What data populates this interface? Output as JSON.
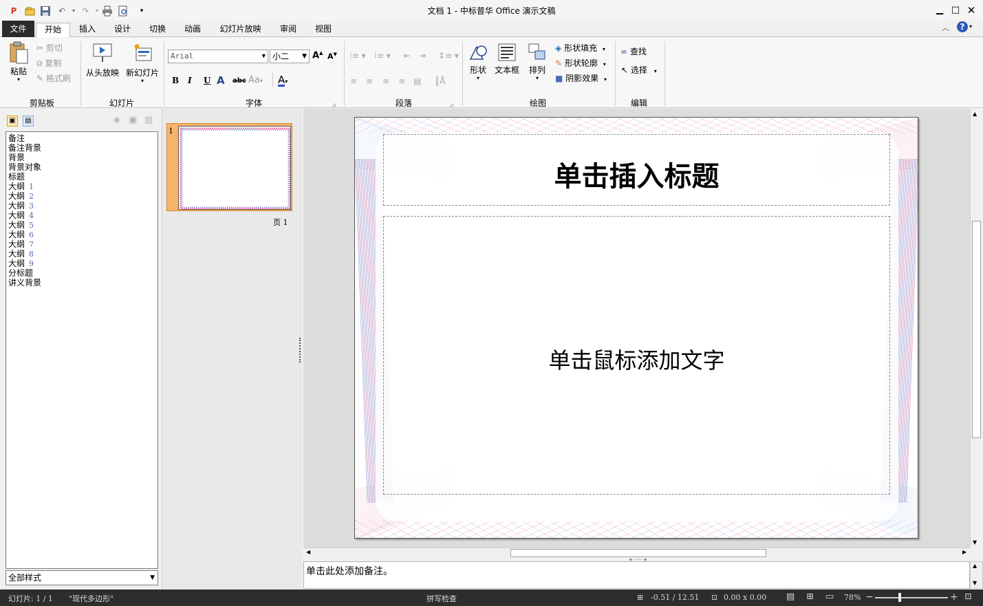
{
  "window": {
    "title": "文档 1 - 中标普华 Office 演示文稿"
  },
  "tabs": [
    {
      "label": "文件"
    },
    {
      "label": "开始"
    },
    {
      "label": "插入"
    },
    {
      "label": "设计"
    },
    {
      "label": "切换"
    },
    {
      "label": "动画"
    },
    {
      "label": "幻灯片放映"
    },
    {
      "label": "审阅"
    },
    {
      "label": "视图"
    }
  ],
  "ribbon": {
    "clipboard": {
      "label": "剪贴板",
      "paste": "粘贴",
      "cut": "剪切",
      "copy": "复制",
      "format_painter": "格式刷"
    },
    "slides": {
      "label": "幻灯片",
      "from_start": "从头放映",
      "new_slide": "新幻灯片"
    },
    "font": {
      "label": "字体",
      "font_name": "Arial",
      "font_size": "小二",
      "bold": "B",
      "italic": "I",
      "underline": "U",
      "strike": "abc",
      "case": "Aa",
      "color_letter": "A"
    },
    "paragraph": {
      "label": "段落"
    },
    "drawing": {
      "label": "绘图",
      "shapes": "形状",
      "textbox": "文本框",
      "arrange": "排列",
      "shape_fill": "形状填充",
      "shape_outline": "形状轮廓",
      "shadow_effect": "阴影效果"
    },
    "editing": {
      "label": "编辑",
      "find": "查找",
      "select": "选择"
    }
  },
  "styles_panel": {
    "items": [
      {
        "label": "备注",
        "num": ""
      },
      {
        "label": "备注背景",
        "num": ""
      },
      {
        "label": "背景",
        "num": ""
      },
      {
        "label": "背景对象",
        "num": ""
      },
      {
        "label": "标题",
        "num": ""
      },
      {
        "label": "大纲",
        "num": "1"
      },
      {
        "label": "大纲",
        "num": "2"
      },
      {
        "label": "大纲",
        "num": "3"
      },
      {
        "label": "大纲",
        "num": "4"
      },
      {
        "label": "大纲",
        "num": "5"
      },
      {
        "label": "大纲",
        "num": "6"
      },
      {
        "label": "大纲",
        "num": "7"
      },
      {
        "label": "大纲",
        "num": "8"
      },
      {
        "label": "大纲",
        "num": "9"
      },
      {
        "label": "分标题",
        "num": ""
      },
      {
        "label": "讲义背景",
        "num": ""
      }
    ],
    "filter": "全部样式"
  },
  "thumbnails": {
    "slide_number": "1",
    "page_label": "页 1"
  },
  "slide": {
    "title_placeholder": "单击插入标题",
    "body_placeholder": "单击鼠标添加文字"
  },
  "notes": {
    "placeholder": "单击此处添加备注。"
  },
  "status": {
    "slide_info": "幻灯片: 1 / 1",
    "theme": "\"现代多边形\"",
    "spell_check": "拼写检查",
    "position": "-0.51 / 12.51",
    "size": "0.00 x 0.00",
    "zoom": "78%"
  },
  "colors": {
    "accent_pink": "#d84a8a",
    "accent_blue": "#4a8ad8",
    "thumb_highlight": "#f4a460",
    "status_bg": "#2d2d2d"
  }
}
